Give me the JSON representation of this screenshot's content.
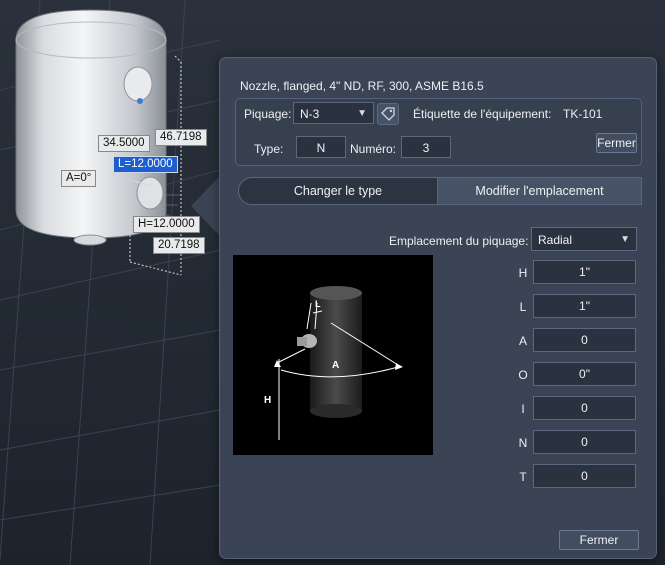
{
  "viewport": {
    "dims": {
      "d1": "34.5000",
      "d2": "46.7198",
      "l_active": "L=12.0000",
      "angle": "A=0°",
      "height": "H=12.0000",
      "d3": "20.7198"
    }
  },
  "dialog": {
    "title": "Nozzle, flanged, 4\" ND, RF, 300, ASME B16.5",
    "piquage_label": "Piquage:",
    "piquage_value": "N-3",
    "tag_label": "Étiquette de l'équipement:",
    "tag_value": "TK-101",
    "type_label": "Type:",
    "type_value": "N",
    "numero_label": "Numéro:",
    "numero_value": "3",
    "close_small": "Fermer",
    "tabs": [
      {
        "label": "Changer le type"
      },
      {
        "label": "Modifier l'emplacement"
      }
    ],
    "emplacement_label": "Emplacement du piquage:",
    "emplacement_value": "Radial",
    "params": [
      {
        "label": "H",
        "value": "1\""
      },
      {
        "label": "L",
        "value": "1\""
      },
      {
        "label": "A",
        "value": "0"
      },
      {
        "label": "O",
        "value": "0\""
      },
      {
        "label": "I",
        "value": "0"
      },
      {
        "label": "N",
        "value": "0"
      },
      {
        "label": "T",
        "value": "0"
      }
    ],
    "preview_labels": {
      "l": "L",
      "a": "A",
      "h": "H"
    },
    "close_button": "Fermer"
  },
  "colors": {
    "panel_bg": "#3a4454",
    "field_bg": "#2a3240",
    "active_dim": "#1d5fd0"
  }
}
